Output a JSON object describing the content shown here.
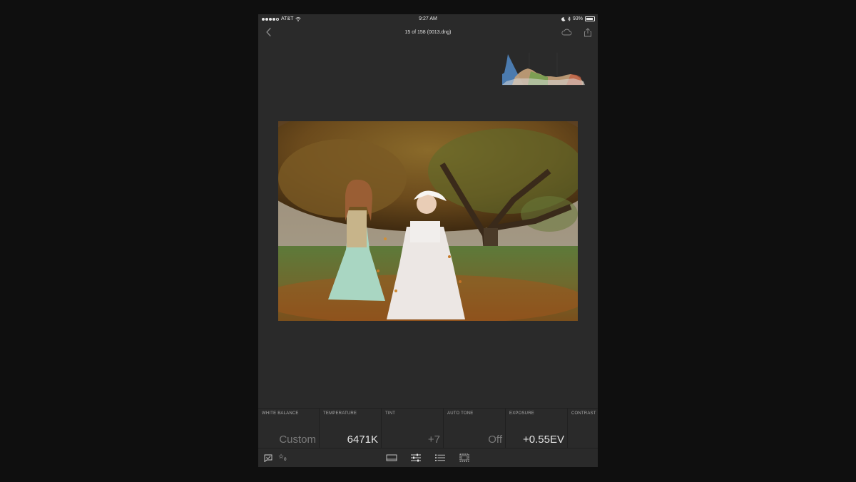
{
  "status_bar": {
    "carrier": "AT&T",
    "time": "9:27 AM",
    "battery": "93%"
  },
  "header": {
    "title": "15 of 158 (0013.dng)"
  },
  "adjustments": [
    {
      "label": "WHITE BALANCE",
      "value": "Custom"
    },
    {
      "label": "TEMPERATURE",
      "value": "6471K"
    },
    {
      "label": "TINT",
      "value": "+7"
    },
    {
      "label": "AUTO TONE",
      "value": "Off"
    },
    {
      "label": "EXPOSURE",
      "value": "+0.55EV"
    },
    {
      "label": "CONTRAST",
      "value": ""
    }
  ],
  "toolbar": {
    "rating_count": "0",
    "icons": [
      "flag-icon",
      "star-icon",
      "filmstrip-icon",
      "sliders-icon",
      "presets-list-icon",
      "crop-icon"
    ]
  },
  "colors": {
    "background": "#0f0f0f",
    "panel": "#2a2a2a",
    "histogram_blue": "#4d7fb6",
    "histogram_tan": "#c7a27a",
    "histogram_green": "#6aa04a",
    "histogram_red": "#c25a3e"
  }
}
